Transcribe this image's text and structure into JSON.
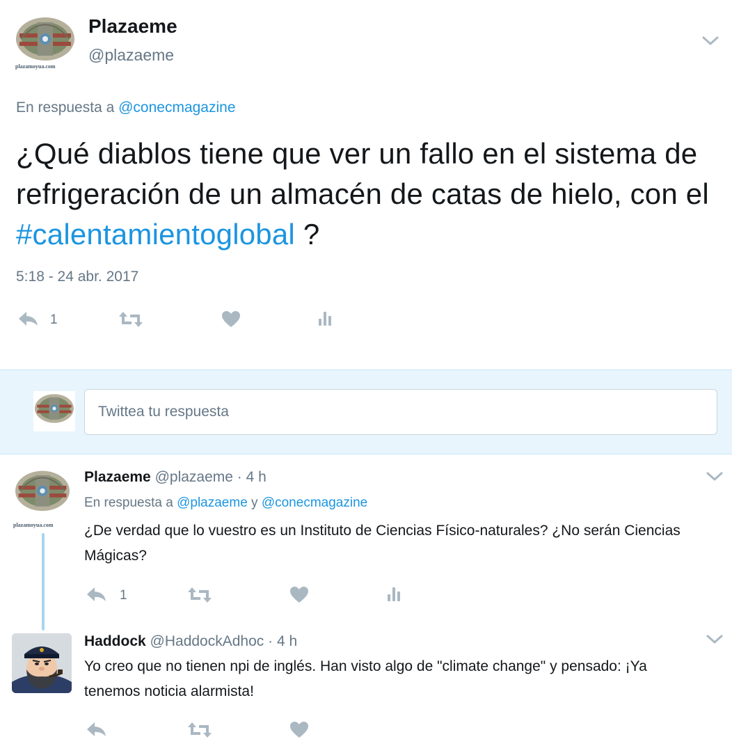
{
  "main_tweet": {
    "name": "Plazaeme",
    "handle": "@plazaeme",
    "avatar_caption": "plazamoyua.com",
    "reply_prefix": "En respuesta a ",
    "reply_to": "@conecmagazine",
    "text_before": "¿Qué diablos tiene que ver un fallo en el sistema de refrigeración de un almacén de catas de hielo, con el ",
    "hashtag": "#calentamientoglobal",
    "text_after": " ?",
    "timestamp": "5:18 - 24 abr. 2017",
    "reply_count": "1",
    "icons": [
      "reply-icon",
      "retweet-icon",
      "like-icon",
      "analytics-icon",
      "chevron-down-icon"
    ]
  },
  "reply_box": {
    "placeholder": "Twittea tu respuesta"
  },
  "replies": [
    {
      "name": "Plazaeme",
      "handle": "@plazaeme",
      "sep": " · ",
      "age": "4 h",
      "avatar_caption": "plazamoyua.com",
      "reply_prefix": "En respuesta a ",
      "reply_to_1": "@plazaeme",
      "reply_and": " y ",
      "reply_to_2": "@conecmagazine",
      "text": "¿De verdad que lo vuestro es un  Instituto de Ciencias Físico-naturales? ¿No serán Ciencias Mágicas?",
      "reply_count": "1"
    },
    {
      "name": "Haddock",
      "handle": "@HaddockAdhoc",
      "sep": " · ",
      "age": "4 h",
      "text": "Yo creo que no tienen npi de inglés. Han visto algo de \"climate change\" y pensado: ¡Ya tenemos noticia alarmista!"
    }
  ],
  "colors": {
    "link": "#1b95e0",
    "muted": "#657786",
    "text": "#14171a",
    "icon": "#aab8c2",
    "reply_band": "#e8f5fd",
    "thread_line": "#a9d4ed"
  }
}
